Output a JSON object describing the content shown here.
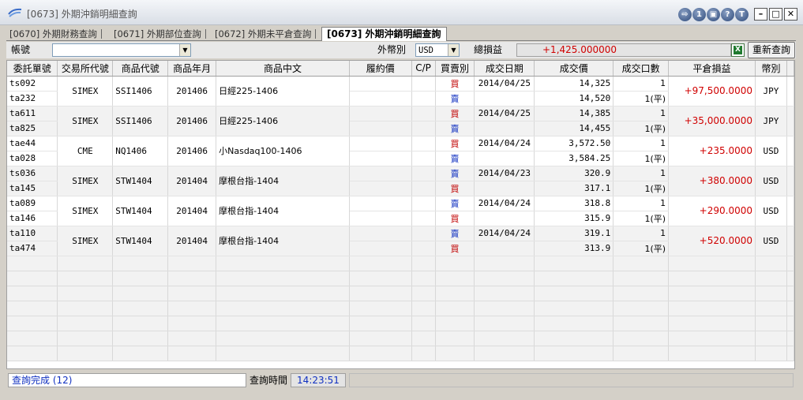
{
  "window": {
    "title": "[0673] 外期沖銷明細查詢",
    "title_icons": [
      {
        "name": "export-icon",
        "glyph": "⇨"
      },
      {
        "name": "info-icon",
        "glyph": "1"
      },
      {
        "name": "print-icon",
        "glyph": "▣"
      },
      {
        "name": "help-icon",
        "glyph": "?"
      },
      {
        "name": "topmost-icon",
        "glyph": "T"
      }
    ]
  },
  "tabs": [
    {
      "label": "[0670] 外期財務查詢",
      "active": false
    },
    {
      "label": "[0671] 外期部位查詢",
      "active": false
    },
    {
      "label": "[0672] 外期未平倉查詢",
      "active": false
    },
    {
      "label": "[0673] 外期沖銷明細查詢",
      "active": true
    }
  ],
  "filter": {
    "account_label": "帳號",
    "account_value": "",
    "currency_label": "外幣別",
    "currency_value": "USD",
    "total_pnl_label": "總損益",
    "total_pnl_value": "+1,425.000000",
    "requery_label": "重新查詢",
    "excel_glyph": "X"
  },
  "columns": [
    "委託單號",
    "交易所代號",
    "商品代號",
    "商品年月",
    "商品中文",
    "履約價",
    "C/P",
    "買賣別",
    "成交日期",
    "成交價",
    "成交口數",
    "平倉損益",
    "幣別"
  ],
  "groups": [
    {
      "exchange": "SIMEX",
      "code": "SSI1406",
      "ym": "201406",
      "name": "日經225-1406",
      "pnl": "+97,500.0000",
      "ccy": "JPY",
      "legs": [
        {
          "order": "ts092",
          "side": "買",
          "side_type": "buy",
          "date": "2014/04/25",
          "price": "14,325",
          "qty": "1"
        },
        {
          "order": "ta232",
          "side": "賣",
          "side_type": "sell",
          "date": "",
          "price": "14,520",
          "qty": "1(平)"
        }
      ]
    },
    {
      "exchange": "SIMEX",
      "code": "SSI1406",
      "ym": "201406",
      "name": "日經225-1406",
      "pnl": "+35,000.0000",
      "ccy": "JPY",
      "legs": [
        {
          "order": "ta611",
          "side": "買",
          "side_type": "buy",
          "date": "2014/04/25",
          "price": "14,385",
          "qty": "1"
        },
        {
          "order": "ta825",
          "side": "賣",
          "side_type": "sell",
          "date": "",
          "price": "14,455",
          "qty": "1(平)"
        }
      ]
    },
    {
      "exchange": "CME",
      "code": "NQ1406",
      "ym": "201406",
      "name": "小Nasdaq100-1406",
      "pnl": "+235.0000",
      "ccy": "USD",
      "legs": [
        {
          "order": "tae44",
          "side": "買",
          "side_type": "buy",
          "date": "2014/04/24",
          "price": "3,572.50",
          "qty": "1"
        },
        {
          "order": "ta028",
          "side": "賣",
          "side_type": "sell",
          "date": "",
          "price": "3,584.25",
          "qty": "1(平)"
        }
      ]
    },
    {
      "exchange": "SIMEX",
      "code": "STW1404",
      "ym": "201404",
      "name": "摩根台指-1404",
      "pnl": "+380.0000",
      "ccy": "USD",
      "legs": [
        {
          "order": "ts036",
          "side": "賣",
          "side_type": "sell",
          "date": "2014/04/23",
          "price": "320.9",
          "qty": "1"
        },
        {
          "order": "ta145",
          "side": "買",
          "side_type": "buy",
          "date": "",
          "price": "317.1",
          "qty": "1(平)"
        }
      ]
    },
    {
      "exchange": "SIMEX",
      "code": "STW1404",
      "ym": "201404",
      "name": "摩根台指-1404",
      "pnl": "+290.0000",
      "ccy": "USD",
      "legs": [
        {
          "order": "ta089",
          "side": "賣",
          "side_type": "sell",
          "date": "2014/04/24",
          "price": "318.8",
          "qty": "1"
        },
        {
          "order": "ta146",
          "side": "買",
          "side_type": "buy",
          "date": "",
          "price": "315.9",
          "qty": "1(平)"
        }
      ]
    },
    {
      "exchange": "SIMEX",
      "code": "STW1404",
      "ym": "201404",
      "name": "摩根台指-1404",
      "pnl": "+520.0000",
      "ccy": "USD",
      "legs": [
        {
          "order": "ta110",
          "side": "賣",
          "side_type": "sell",
          "date": "2014/04/24",
          "price": "319.1",
          "qty": "1"
        },
        {
          "order": "ta474",
          "side": "買",
          "side_type": "buy",
          "date": "",
          "price": "313.9",
          "qty": "1(平)"
        }
      ]
    }
  ],
  "status": {
    "message": "查詢完成 (12)",
    "time_label": "查詢時間",
    "time_value": "14:23:51"
  }
}
